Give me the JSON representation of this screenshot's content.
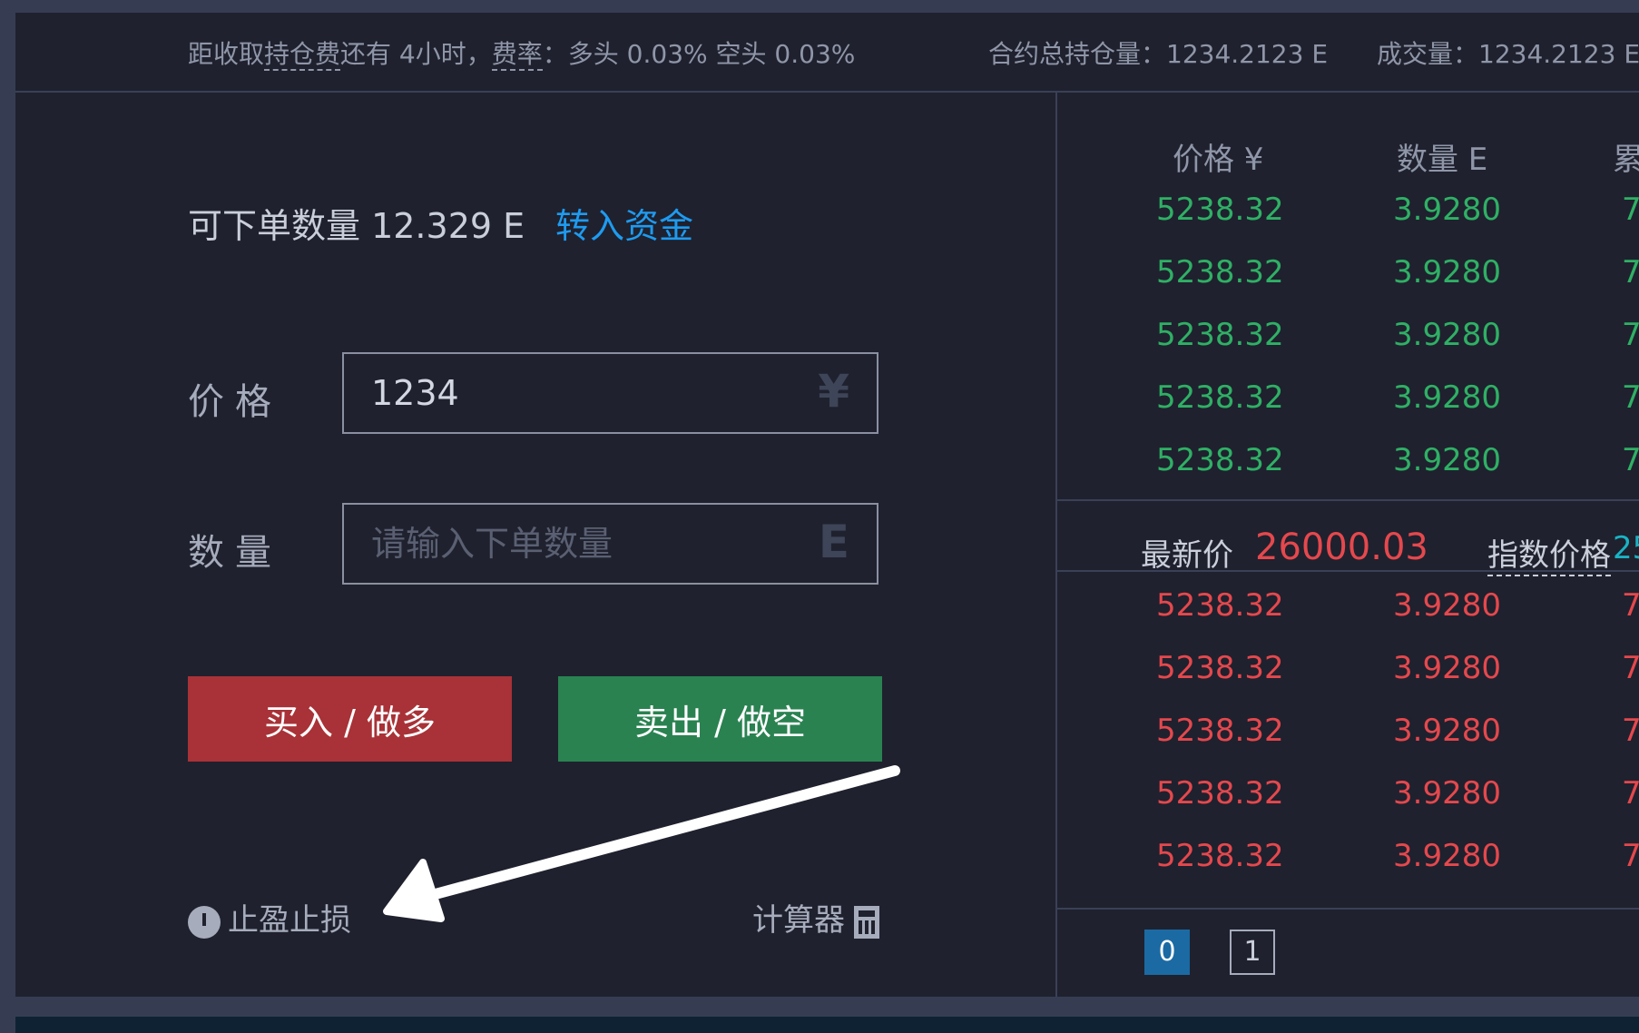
{
  "topbar": {
    "fee_prefix": "距收取",
    "fee_term": "持仓费",
    "fee_suffix": "还有 4小时，",
    "rate_term": "费率",
    "rate_values": "：多头 0.03%  空头 0.03%",
    "open_interest_label": "合约总持仓量：",
    "open_interest_value": "1234.2123 E",
    "volume_label": "成交量：",
    "volume_value": "1234.2123 E"
  },
  "order_form": {
    "available": "可下单数量 12.329 E",
    "transfer_link": "转入资金",
    "price_label": "价格",
    "price_value": "1234",
    "price_unit": "¥",
    "qty_label": "数量",
    "qty_placeholder": "请输入下单数量",
    "qty_unit": "E",
    "buy_label": "买入 / 做多",
    "sell_label": "卖出 / 做空",
    "stop_label": "止盈止损",
    "calc_label": "计算器"
  },
  "orderbook": {
    "headers": [
      "价格 ¥",
      "数量 E",
      "累"
    ],
    "asks": [
      {
        "price": "5238.32",
        "qty": "3.9280",
        "total": "7"
      },
      {
        "price": "5238.32",
        "qty": "3.9280",
        "total": "7"
      },
      {
        "price": "5238.32",
        "qty": "3.9280",
        "total": "7"
      },
      {
        "price": "5238.32",
        "qty": "3.9280",
        "total": "7"
      },
      {
        "price": "5238.32",
        "qty": "3.9280",
        "total": "7"
      }
    ],
    "last_label": "最新价",
    "last_value": "26000.03",
    "index_label": "指数价格",
    "index_value": "25",
    "bids": [
      {
        "price": "5238.32",
        "qty": "3.9280",
        "total": "7"
      },
      {
        "price": "5238.32",
        "qty": "3.9280",
        "total": "7"
      },
      {
        "price": "5238.32",
        "qty": "3.9280",
        "total": "7"
      },
      {
        "price": "5238.32",
        "qty": "3.9280",
        "total": "7"
      },
      {
        "price": "5238.32",
        "qty": "3.9280",
        "total": "7"
      }
    ],
    "pages": [
      "0",
      "1"
    ]
  },
  "colors": {
    "ask": "#2fb065",
    "bid": "#e5484d",
    "buy_button": "#a83237",
    "sell_button": "#2a8251",
    "link": "#1e9bf0",
    "active_page": "#1b6aa3"
  },
  "icons": [
    "timer-icon",
    "calculator-icon",
    "annotation-arrow"
  ]
}
